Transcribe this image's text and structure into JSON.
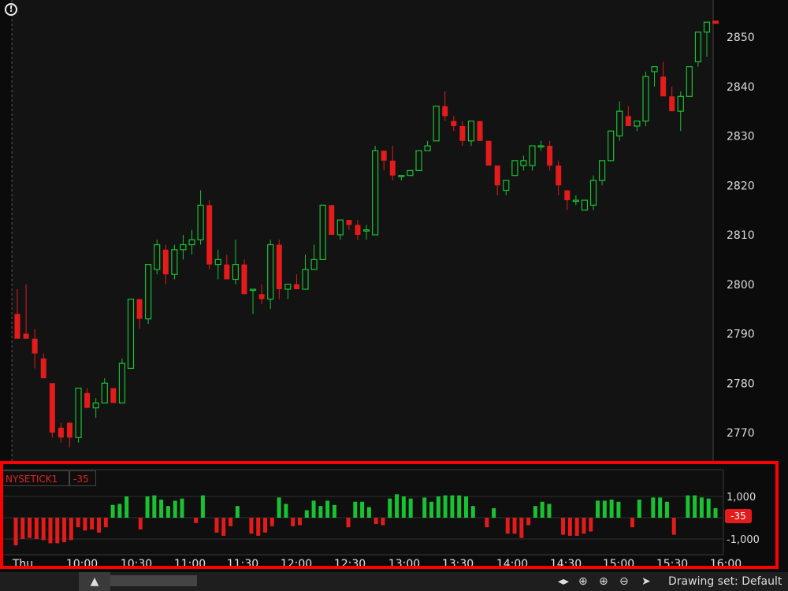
{
  "chart_data": [
    {
      "type": "candlestick",
      "y_ticks": [
        2770,
        2780,
        2790,
        2800,
        2810,
        2820,
        2830,
        2840,
        2850
      ],
      "ylim": [
        2767,
        2858
      ],
      "last_price": 2853,
      "candles": [
        [
          2794,
          2799,
          2790,
          2789
        ],
        [
          2790,
          2800,
          2789,
          2789
        ],
        [
          2789,
          2791,
          2783,
          2786
        ],
        [
          2785,
          2786,
          2781,
          2781
        ],
        [
          2780,
          2780,
          2769,
          2770
        ],
        [
          2771,
          2772,
          2768,
          2769
        ],
        [
          2772,
          2772,
          2767,
          2769
        ],
        [
          2769,
          2779,
          2768,
          2779
        ],
        [
          2778,
          2779,
          2775,
          2775
        ],
        [
          2775,
          2777,
          2773,
          2776
        ],
        [
          2776,
          2781,
          2776,
          2780
        ],
        [
          2779,
          2779,
          2776,
          2776
        ],
        [
          2776,
          2785,
          2776,
          2784
        ],
        [
          2783,
          2797,
          2783,
          2797
        ],
        [
          2797,
          2797,
          2791,
          2793
        ],
        [
          2793,
          2804,
          2792,
          2804
        ],
        [
          2803,
          2809,
          2802,
          2808
        ],
        [
          2807,
          2808,
          2800,
          2802
        ],
        [
          2802,
          2808,
          2801,
          2807
        ],
        [
          2807,
          2810,
          2805,
          2808
        ],
        [
          2808,
          2811,
          2806,
          2809
        ],
        [
          2809,
          2819,
          2808,
          2816
        ],
        [
          2816,
          2817,
          2803,
          2804
        ],
        [
          2804,
          2807,
          2801,
          2805
        ],
        [
          2804,
          2806,
          2801,
          2801
        ],
        [
          2801,
          2809,
          2800,
          2804
        ],
        [
          2804,
          2805,
          2798,
          2798
        ],
        [
          2799,
          2799,
          2794,
          2799
        ],
        [
          2798,
          2800,
          2796,
          2797
        ],
        [
          2797,
          2809,
          2795,
          2808
        ],
        [
          2808,
          2809,
          2797,
          2799
        ],
        [
          2799,
          2800,
          2797,
          2800
        ],
        [
          2800,
          2802,
          2799,
          2799
        ],
        [
          2799,
          2806,
          2799,
          2803
        ],
        [
          2803,
          2808,
          2804,
          2805
        ],
        [
          2805,
          2816,
          2805,
          2816
        ],
        [
          2816,
          2816,
          2810,
          2810
        ],
        [
          2810,
          2813,
          2809,
          2813
        ],
        [
          2813,
          2813,
          2811,
          2812
        ],
        [
          2812,
          2813,
          2809,
          2810
        ],
        [
          2811,
          2812,
          2809,
          2811
        ],
        [
          2810,
          2828,
          2810,
          2827
        ],
        [
          2827,
          2827,
          2823,
          2825
        ],
        [
          2825,
          2828,
          2821,
          2822
        ],
        [
          2822,
          2822,
          2821,
          2822
        ],
        [
          2822,
          2823,
          2822,
          2823
        ],
        [
          2823,
          2827,
          2823,
          2827
        ],
        [
          2827,
          2829,
          2827,
          2828
        ],
        [
          2829,
          2836,
          2829,
          2836
        ],
        [
          2836,
          2839,
          2833,
          2834
        ],
        [
          2833,
          2834,
          2831,
          2832
        ],
        [
          2832,
          2833,
          2828,
          2829
        ],
        [
          2829,
          2833,
          2828,
          2833
        ],
        [
          2833,
          2833,
          2829,
          2829
        ],
        [
          2829,
          2829,
          2824,
          2824
        ],
        [
          2824,
          2824,
          2818,
          2820
        ],
        [
          2819,
          2821,
          2818,
          2821
        ],
        [
          2822,
          2825,
          2822,
          2825
        ],
        [
          2824,
          2826,
          2823,
          2825
        ],
        [
          2824,
          2828,
          2823,
          2828
        ],
        [
          2828,
          2829,
          2827,
          2828
        ],
        [
          2828,
          2829,
          2823,
          2824
        ],
        [
          2824,
          2825,
          2818,
          2820
        ],
        [
          2819,
          2819,
          2815,
          2817
        ],
        [
          2817,
          2818,
          2816,
          2817
        ],
        [
          2815,
          2817,
          2815,
          2817
        ],
        [
          2816,
          2822,
          2815,
          2821
        ],
        [
          2821,
          2823,
          2820,
          2825
        ],
        [
          2825,
          2831,
          2825,
          2831
        ],
        [
          2830,
          2837,
          2829,
          2835
        ],
        [
          2834,
          2836,
          2833,
          2832
        ],
        [
          2832,
          2833,
          2831,
          2833
        ],
        [
          2833,
          2843,
          2832,
          2842
        ],
        [
          2843,
          2843,
          2840,
          2844
        ],
        [
          2842,
          2845,
          2839,
          2838
        ],
        [
          2838,
          2840,
          2835,
          2835
        ],
        [
          2835,
          2839,
          2831,
          2838
        ],
        [
          2838,
          2844,
          2838,
          2844
        ],
        [
          2845,
          2851,
          2844,
          2851
        ],
        [
          2851,
          2853,
          2846,
          2853
        ]
      ]
    },
    {
      "type": "bar",
      "name": "NYSETICK1",
      "current_value": "-35",
      "y_ticks": [
        "1,000",
        "-1,000"
      ],
      "x_labels": [
        "Thu",
        "10:00",
        "10:30",
        "11:00",
        "11:30",
        "12:00",
        "12:30",
        "13:00",
        "13:30",
        "14:00",
        "14:30",
        "15:00",
        "15:30",
        "16:00"
      ],
      "values": [
        -1300,
        -1000,
        -950,
        -1000,
        -1050,
        -1200,
        -1200,
        -1150,
        -1050,
        -450,
        -600,
        -550,
        -700,
        -450,
        600,
        650,
        1000,
        0,
        -550,
        1000,
        1050,
        850,
        550,
        800,
        900,
        0,
        -250,
        1050,
        0,
        -700,
        -850,
        -400,
        550,
        0,
        -750,
        -850,
        -700,
        -400,
        950,
        650,
        -400,
        -350,
        350,
        800,
        550,
        800,
        600,
        0,
        -450,
        750,
        750,
        500,
        -300,
        -350,
        900,
        1100,
        1000,
        900,
        0,
        950,
        750,
        1000,
        1050,
        1050,
        1050,
        1000,
        550,
        0,
        -450,
        450,
        0,
        -750,
        -750,
        -950,
        -350,
        550,
        750,
        650,
        0,
        -800,
        -850,
        -850,
        -750,
        -650,
        800,
        800,
        850,
        750,
        0,
        -450,
        850,
        0,
        950,
        950,
        750,
        -800,
        0,
        1050,
        1050,
        950,
        900,
        450
      ]
    }
  ],
  "ui": {
    "info_icon": "!",
    "indicator_name": "NYSETICK1",
    "indicator_value": "-35",
    "drawing_set": "Drawing set: Default"
  },
  "colors": {
    "up": "#19c232",
    "down": "#e41b1b",
    "bg": "#0b0b0b",
    "highlight": "#ff0000"
  }
}
